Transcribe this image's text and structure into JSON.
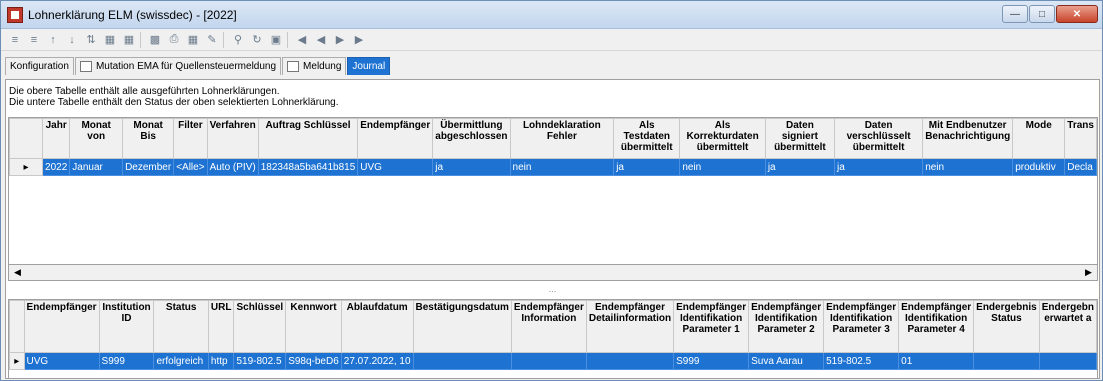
{
  "window": {
    "title": "Lohnerklärung ELM (swissdec) - [2022]"
  },
  "tabs": [
    {
      "label": "Konfiguration"
    },
    {
      "label": "Mutation EMA für Quellensteuermeldung"
    },
    {
      "label": "Meldung"
    },
    {
      "label": "Journal"
    }
  ],
  "description": {
    "line1": "Die obere Tabelle enthält alle ausgeführten Lohnerklärungen.",
    "line2": "Die untere Tabelle enthält den Status der oben selektierten Lohnerklärung."
  },
  "top_table": {
    "columns": [
      "Jahr",
      "Monat von",
      "Monat Bis",
      "Filter",
      "Verfahren",
      "Auftrag Schlüssel",
      "Endempfänger",
      "Übermittlung abgeschlossen",
      "Lohndeklaration Fehler",
      "Als Testdaten übermittelt",
      "Als Korrekturdaten übermittelt",
      "Daten signiert übermittelt",
      "Daten verschlüsselt übermittelt",
      "Mit Endbenutzer Benachrichtigung",
      "Mode",
      "Trans"
    ],
    "row": [
      "2022",
      "Januar",
      "Dezember",
      "<Alle>",
      "Auto (PIV)",
      "182348a5ba641b815",
      "UVG",
      "ja",
      "nein",
      "ja",
      "nein",
      "ja",
      "ja",
      "nein",
      "produktiv",
      "Decla"
    ]
  },
  "bottom_table": {
    "columns": [
      "Endempfänger",
      "Institution ID",
      "Status",
      "URL",
      "Schlüssel",
      "Kennwort",
      "Ablaufdatum",
      "Bestätigungsdatum",
      "Endempfänger Information",
      "Endempfänger Detailinformation",
      "Endempfänger Identifikation Parameter 1",
      "Endempfänger Identifikation Parameter 2",
      "Endempfänger Identifikation Parameter 3",
      "Endempfänger Identifikation Parameter 4",
      "Endergebnis Status",
      "Endergebn erwartet a"
    ],
    "row": [
      "UVG",
      "S999",
      "erfolgreich",
      "http",
      "519-802.5",
      "S98q-beD6",
      "27.07.2022, 10",
      "",
      "",
      "",
      "S999",
      "Suva Aarau",
      "519-802.5",
      "01",
      "",
      ""
    ]
  },
  "splitter": {
    "label": "..."
  }
}
